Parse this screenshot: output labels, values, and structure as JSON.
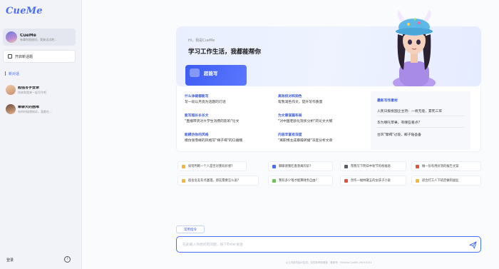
{
  "app": {
    "logo": "CueMe"
  },
  "sidebar": {
    "assistant": {
      "name": "CueMe",
      "subtitle": "有事你直接问，我来试试吧..."
    },
    "new_chat_label": "开启新话题",
    "section_label": "新对话",
    "conversations": [
      {
        "title": "超强写手登录",
        "preview": "快来和我来一起写作吧"
      },
      {
        "title": "聚聊天的困难",
        "preview": "有的时候想倾诉，我都在..."
      }
    ],
    "login_label": "登录",
    "info_label": "i"
  },
  "hero": {
    "subtitle": "Hi，我是CueMe",
    "title": "学习工作生活，我都能帮你",
    "card_label": "超能写"
  },
  "skills": [
    {
      "title": "什么体裁都能写",
      "desc": "写一段以月亮为话题的灯谜"
    },
    {
      "title": "高效校对和润色",
      "desc": "帮我润色作文，提升写作质量"
    },
    {
      "title": "能写超长长长文",
      "desc": "\"直播带货对大学生消费的影响\"论文"
    },
    {
      "title": "为文章谋篇布局",
      "desc": "\"对中国老龄化现状分析\"的论文大纲"
    },
    {
      "title": "能模仿你的风格",
      "desc": "模仿张雪峰的风格写\"梯子喝\"的口播稿"
    },
    {
      "title": "内容丰富有深度",
      "desc": "\"离职博主成暴躁转播\"深度分析文章"
    }
  ],
  "news": {
    "title": "最新写作素材",
    "items": [
      "人民日报批国企主持：一将无能，累死三军",
      "华为哪吒苹果，有哪些看点?",
      "台风\"摩羯\"过境，椰子陆吾备"
    ]
  },
  "suggestions": [
    {
      "text": "如何判断一个人是否对我有好感?",
      "color": "#f5b43c"
    },
    {
      "text": "聊聊请我吃香港离的早?",
      "color": "#4a6cf7"
    },
    {
      "text": "帮我写下明日中秋节的祝福语",
      "color": "#555a66"
    },
    {
      "text": "做一份有用好消的报告文案",
      "color": "#e0533c"
    },
    {
      "text": "宿舍舍友有点邋遢，朋友需要怎么说?",
      "color": "#f5b43c"
    },
    {
      "text": "我有多少钱才能算财务自由?",
      "color": "#6fbf5c"
    },
    {
      "text": "创作一幅林黛玉的女孩子小说",
      "color": "#e0533c"
    },
    {
      "text": "适合打工人下班后做的副业",
      "color": "#f5b43c"
    }
  ],
  "composer": {
    "command_label": "常用指令",
    "placeholder": "在此输入你想问的问题，按下Enter发送",
    "footer": "以上内容均由AI生成，仅供参考和借鉴 · 备案号：Beijing-CueMe-20240101"
  }
}
